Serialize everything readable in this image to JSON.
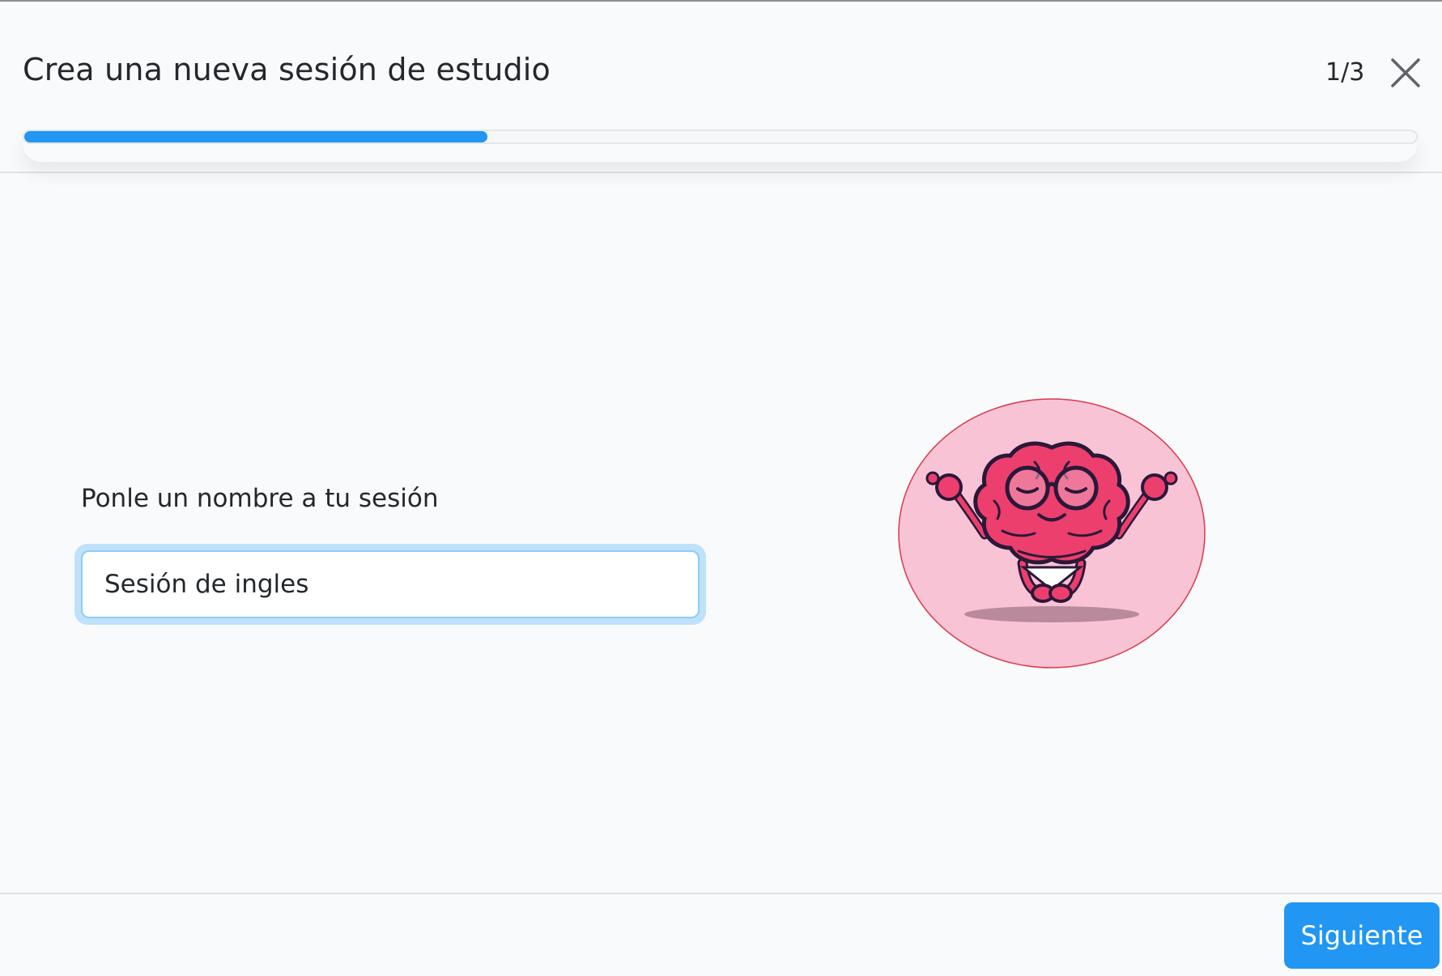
{
  "header": {
    "title": "Crea una nueva sesión de estudio",
    "step": "1/3",
    "close_icon": "close-icon"
  },
  "progress": {
    "fraction": 0.333,
    "color": "#2196f3"
  },
  "form": {
    "name_label": "Ponle un nombre a tu sesión",
    "name_value": "Sesión de ingles"
  },
  "illustration": {
    "icon": "meditating-brain-illustration",
    "circle_color": "#f8c3d5",
    "brain_color": "#ec3f6e"
  },
  "footer": {
    "next_label": "Siguiente"
  },
  "colors": {
    "accent": "#2196f3",
    "background": "#f8fafc"
  }
}
